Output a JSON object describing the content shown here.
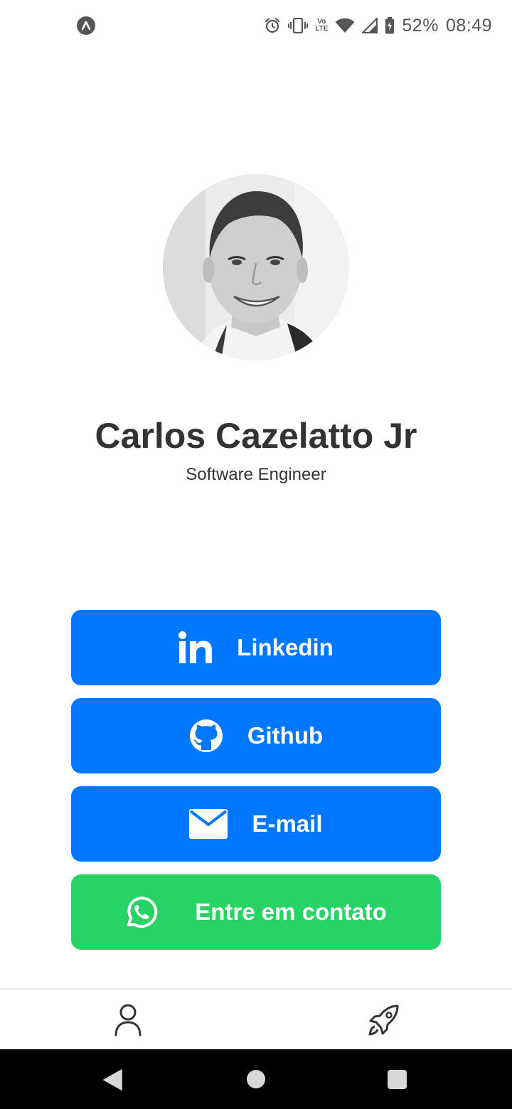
{
  "status_bar": {
    "app_indicator_icon": "expo-icon",
    "icons": [
      "alarm-icon",
      "vibrate-icon",
      "volte-icon",
      "wifi-icon",
      "signal-icon",
      "battery-charging-icon"
    ],
    "volte_label_top": "Vo",
    "volte_label_bottom": "LTE",
    "battery": "52%",
    "time": "08:49"
  },
  "profile": {
    "name": "Carlos Cazelatto Jr",
    "role": "Software Engineer"
  },
  "links": {
    "linkedin": {
      "label": "Linkedin",
      "icon": "linkedin-icon",
      "color": "#0077ff"
    },
    "github": {
      "label": "Github",
      "icon": "github-icon",
      "color": "#0077ff"
    },
    "email": {
      "label": "E-mail",
      "icon": "mail-icon",
      "color": "#0077ff"
    },
    "whatsapp": {
      "label": "Entre em contato",
      "icon": "whatsapp-icon",
      "color": "#28d366"
    }
  },
  "tab_bar": {
    "tabs": [
      {
        "icon": "user-icon",
        "active": true
      },
      {
        "icon": "rocket-icon",
        "active": false
      }
    ]
  },
  "nav_bar": {
    "buttons": [
      "back-icon",
      "home-icon",
      "recents-icon"
    ]
  }
}
